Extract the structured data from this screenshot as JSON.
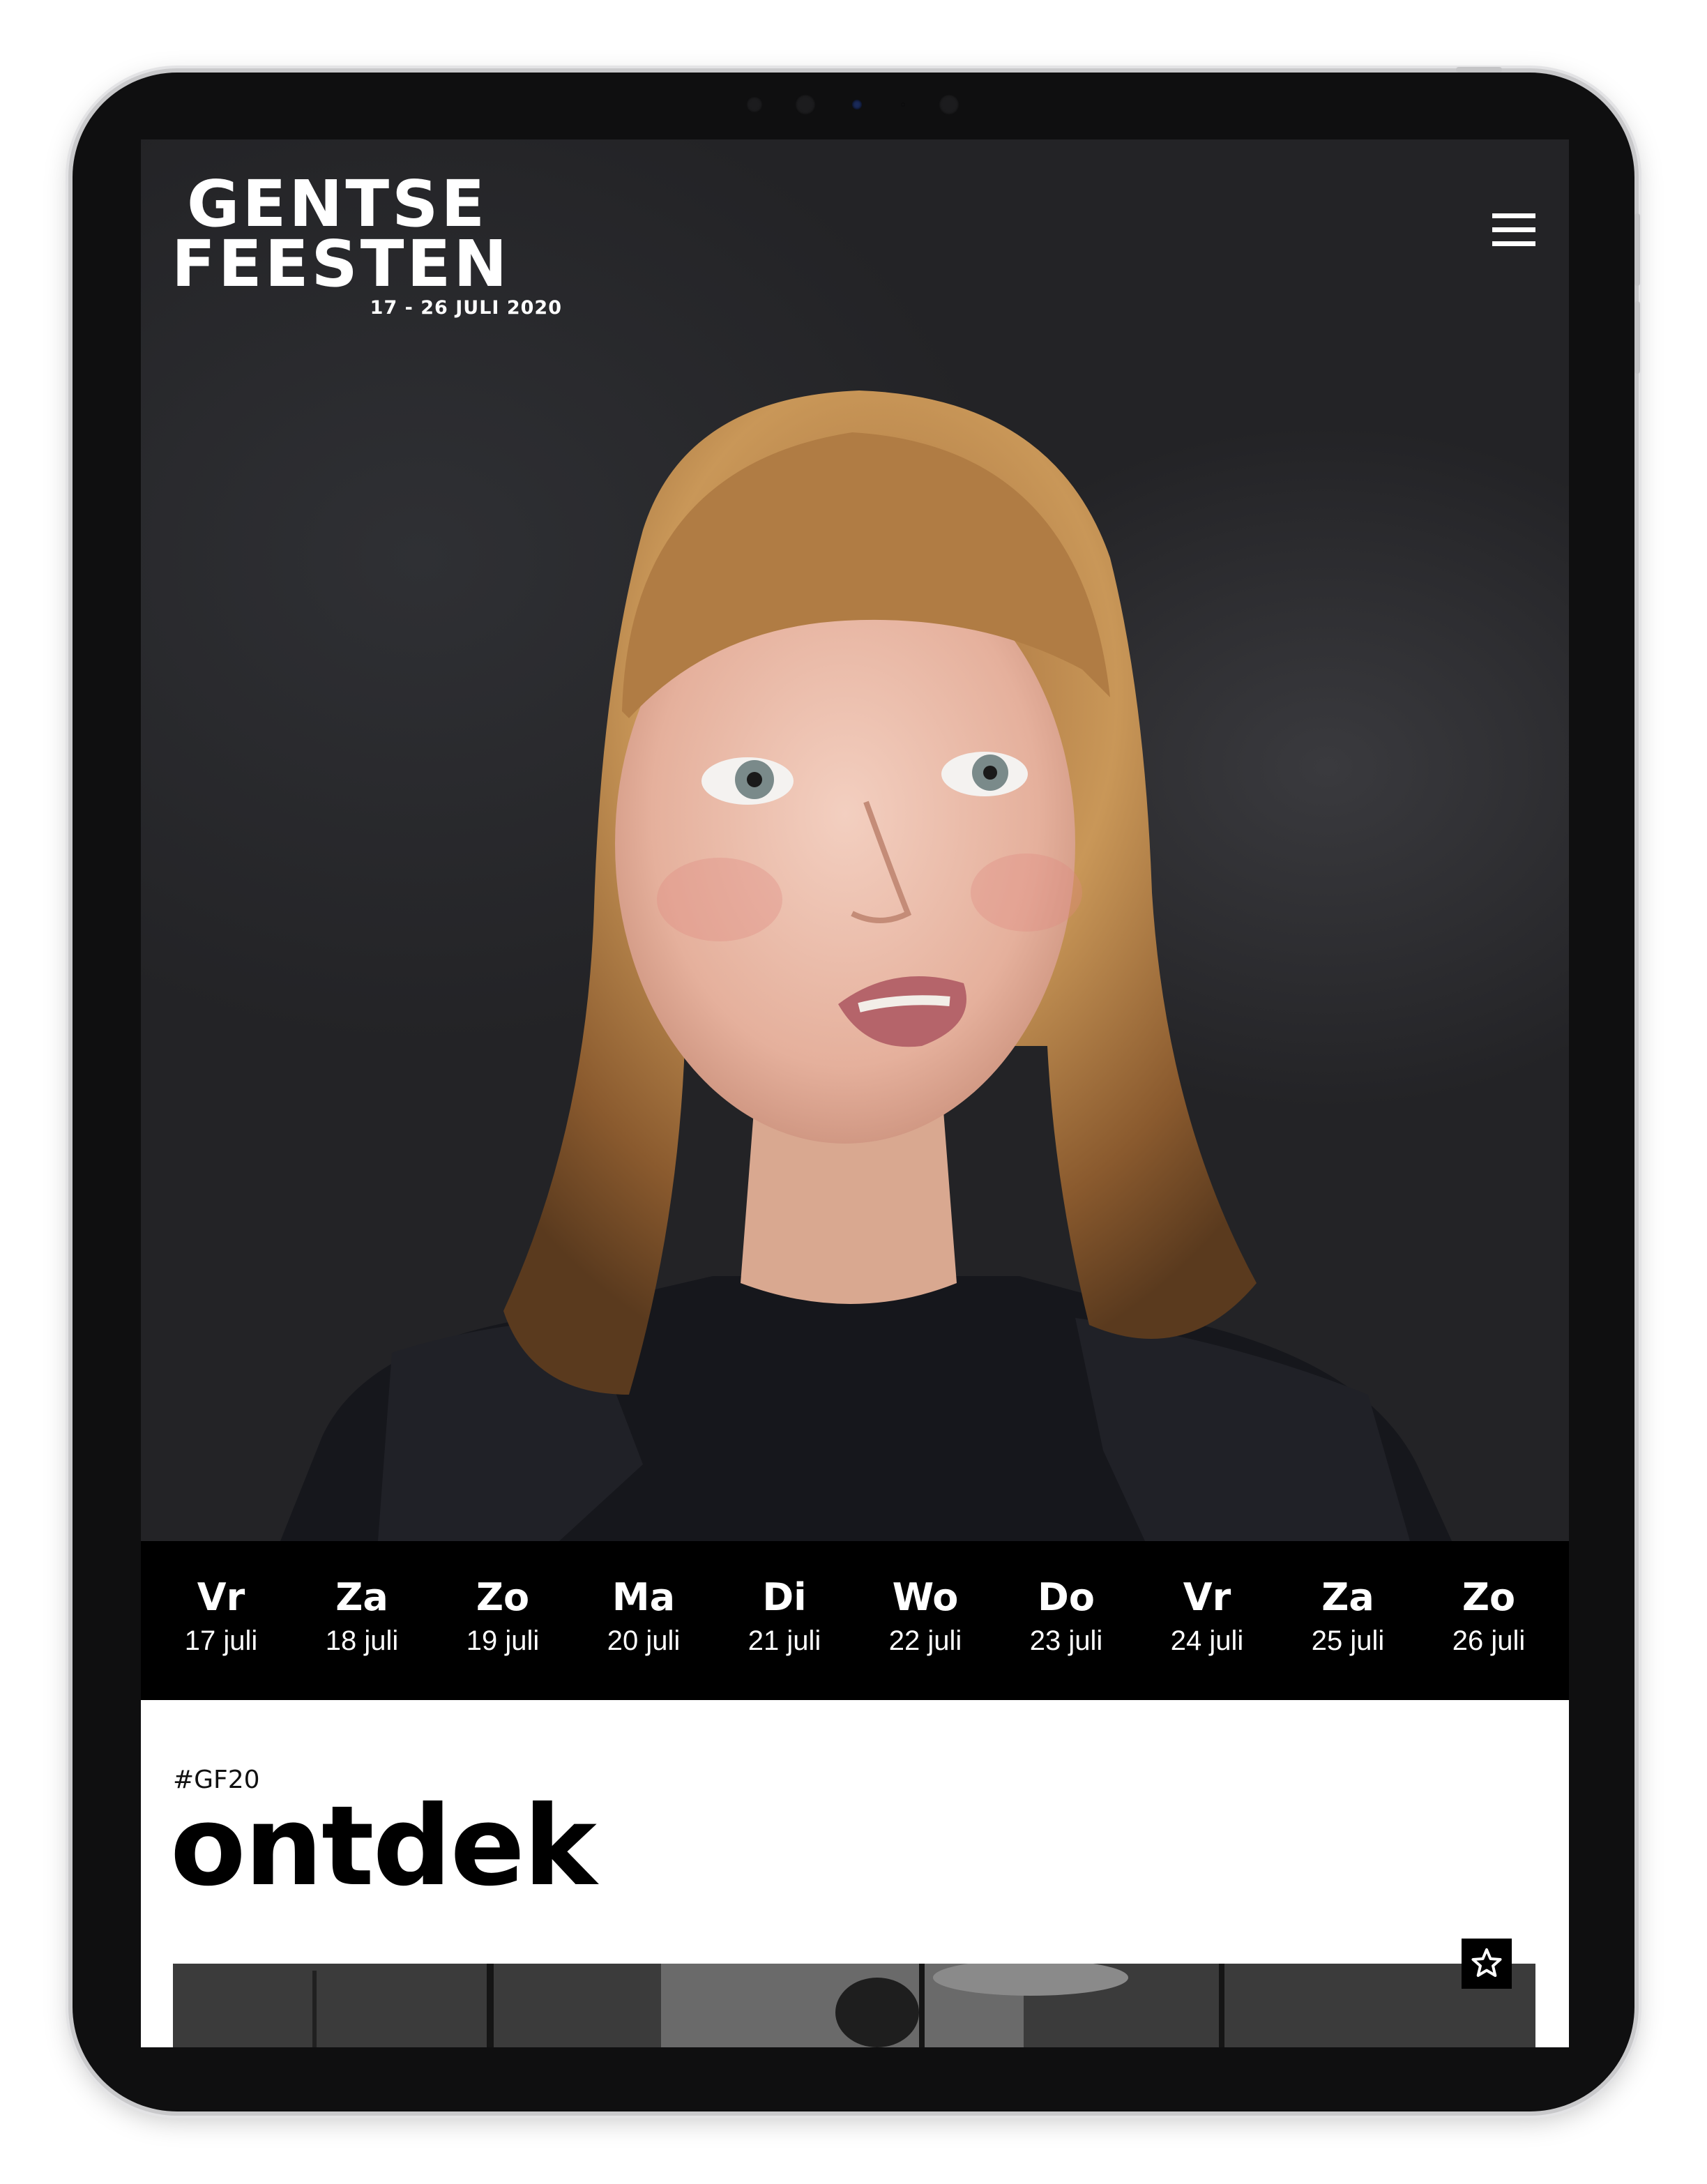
{
  "header": {
    "logo_line1": "GENTSE",
    "logo_line2": "FEESTEN",
    "logo_dates": "17 - 26 JULI 2020",
    "menu_icon": "hamburger-menu-icon"
  },
  "days": [
    {
      "name": "Vr",
      "date": "17 juli"
    },
    {
      "name": "Za",
      "date": "18 juli"
    },
    {
      "name": "Zo",
      "date": "19 juli"
    },
    {
      "name": "Ma",
      "date": "20 juli"
    },
    {
      "name": "Di",
      "date": "21 juli"
    },
    {
      "name": "Wo",
      "date": "22 juli"
    },
    {
      "name": "Do",
      "date": "23 juli"
    },
    {
      "name": "Vr",
      "date": "24 juli"
    },
    {
      "name": "Za",
      "date": "25 juli"
    },
    {
      "name": "Zo",
      "date": "26 juli"
    }
  ],
  "section": {
    "hashtag": "#GF20",
    "title": "ontdek",
    "favorite_icon": "star-outline-icon"
  },
  "colors": {
    "daybar_bg": "#000000",
    "hero_bg": "#232326",
    "text_light": "#ffffff",
    "text_dark": "#000000"
  }
}
